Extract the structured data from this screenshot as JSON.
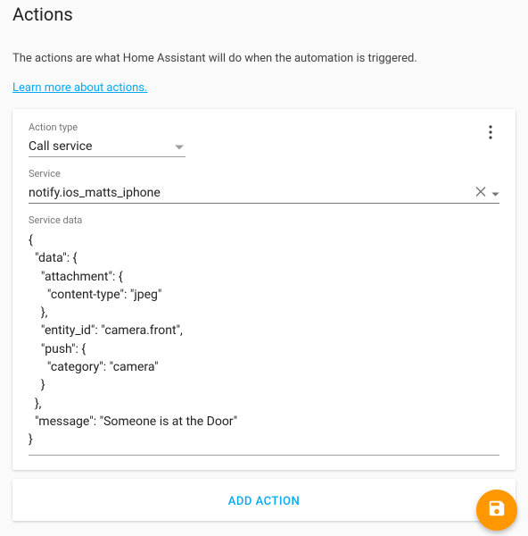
{
  "header": {
    "title": "Actions",
    "description": "The actions are what Home Assistant will do when the automation is triggered.",
    "learn_link": "Learn more about actions."
  },
  "action_card": {
    "action_type_label": "Action type",
    "action_type_value": "Call service",
    "service_label": "Service",
    "service_value": "notify.ios_matts_iphone",
    "service_data_label": "Service data",
    "service_data_value": "{\n  \"data\": {\n    \"attachment\": {\n      \"content-type\": \"jpeg\"\n    },\n    \"entity_id\": \"camera.front\",\n    \"push\": {\n      \"category\": \"camera\"\n    }\n  },\n  \"message\": \"Someone is at the Door\"\n}"
  },
  "add_action_label": "ADD ACTION"
}
